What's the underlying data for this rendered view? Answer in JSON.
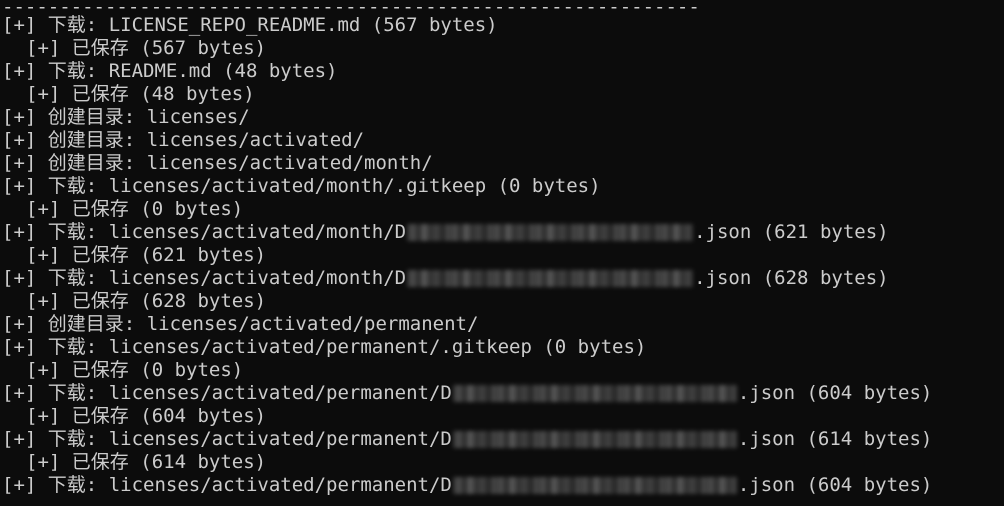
{
  "separator": "-------------------------------------------------------------",
  "lines": [
    {
      "type": "download",
      "prefix": "[+]",
      "label": "下载:",
      "text": "LICENSE_REPO_README.md (567 bytes)"
    },
    {
      "type": "saved",
      "prefix": "[+]",
      "label": "已保存",
      "text": "(567 bytes)"
    },
    {
      "type": "download",
      "prefix": "[+]",
      "label": "下载:",
      "text": "README.md (48 bytes)"
    },
    {
      "type": "saved",
      "prefix": "[+]",
      "label": "已保存",
      "text": "(48 bytes)"
    },
    {
      "type": "mkdir",
      "prefix": "[+]",
      "label": "创建目录:",
      "text": "licenses/"
    },
    {
      "type": "mkdir",
      "prefix": "[+]",
      "label": "创建目录:",
      "text": "licenses/activated/"
    },
    {
      "type": "mkdir",
      "prefix": "[+]",
      "label": "创建目录:",
      "text": "licenses/activated/month/"
    },
    {
      "type": "download",
      "prefix": "[+]",
      "label": "下载:",
      "text": "licenses/activated/month/.gitkeep (0 bytes)"
    },
    {
      "type": "saved",
      "prefix": "[+]",
      "label": "已保存",
      "text": "(0 bytes)"
    },
    {
      "type": "download-redacted",
      "prefix": "[+]",
      "label": "下载:",
      "path": "licenses/activated/month/D",
      "suffix": ".json (621 bytes)"
    },
    {
      "type": "saved",
      "prefix": "[+]",
      "label": "已保存",
      "text": "(621 bytes)"
    },
    {
      "type": "download-redacted",
      "prefix": "[+]",
      "label": "下载:",
      "path": "licenses/activated/month/D",
      "suffix": ".json (628 bytes)"
    },
    {
      "type": "saved",
      "prefix": "[+]",
      "label": "已保存",
      "text": "(628 bytes)"
    },
    {
      "type": "mkdir",
      "prefix": "[+]",
      "label": "创建目录:",
      "text": "licenses/activated/permanent/"
    },
    {
      "type": "download",
      "prefix": "[+]",
      "label": "下载:",
      "text": "licenses/activated/permanent/.gitkeep (0 bytes)"
    },
    {
      "type": "saved",
      "prefix": "[+]",
      "label": "已保存",
      "text": "(0 bytes)"
    },
    {
      "type": "download-redacted",
      "prefix": "[+]",
      "label": "下载:",
      "path": "licenses/activated/permanent/D",
      "suffix": ".json (604 bytes)"
    },
    {
      "type": "saved",
      "prefix": "[+]",
      "label": "已保存",
      "text": "(604 bytes)"
    },
    {
      "type": "download-redacted",
      "prefix": "[+]",
      "label": "下载:",
      "path": "licenses/activated/permanent/D",
      "suffix": ".json (614 bytes)"
    },
    {
      "type": "saved",
      "prefix": "[+]",
      "label": "已保存",
      "text": "(614 bytes)"
    },
    {
      "type": "download-redacted",
      "prefix": "[+]",
      "label": "下载:",
      "path": "licenses/activated/permanent/D",
      "suffix": ".json (604 bytes)"
    }
  ],
  "colors": {
    "background": "#0c0c0c",
    "foreground": "#cccccc"
  }
}
